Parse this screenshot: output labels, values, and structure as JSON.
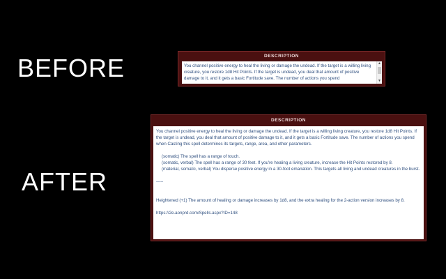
{
  "labels": {
    "before": "BEFORE",
    "after": "AFTER"
  },
  "before_panel": {
    "header": "DESCRIPTION",
    "body": "You channel positive energy to heal the living or damage the undead. If the target is a willing living creature, you restore 1d8 Hit Points. If the target is undead, you deal that amount of positive damage to it, and it gets a basic Fortitude save. The number of actions you spend"
  },
  "after_panel": {
    "header": "DESCRIPTION",
    "intro": "You channel positive energy to heal the living or damage the undead. If the target is a willing living creature, you restore 1d8 Hit Points. If the target is undead, you deal that amount of positive damage to it, and it gets a basic Fortitude save. The number of actions you spend when Casting this spell determines its targets, range, area, and other parameters.",
    "option1": "(somatic) The spell has a range of touch.",
    "option2": "(somatic, verbal) The spell has a range of 30 feet. If you're healing a living creature, increase the Hit Points restored by 8.",
    "option3": "(material, somatic, verbal) You disperse positive energy in a 30-foot emanation. This targets all living and undead creatures in the burst.",
    "divider": "-----",
    "heightened": "Heightened (+1) The amount of healing or damage increases by 1d8, and the extra healing for the 2-action version increases by 8.",
    "link": "https://2e.aonprd.com/Spells.aspx?ID=148"
  },
  "colors": {
    "panel": "#4a1010",
    "text": "#2f4f7f",
    "background": "#000000"
  }
}
